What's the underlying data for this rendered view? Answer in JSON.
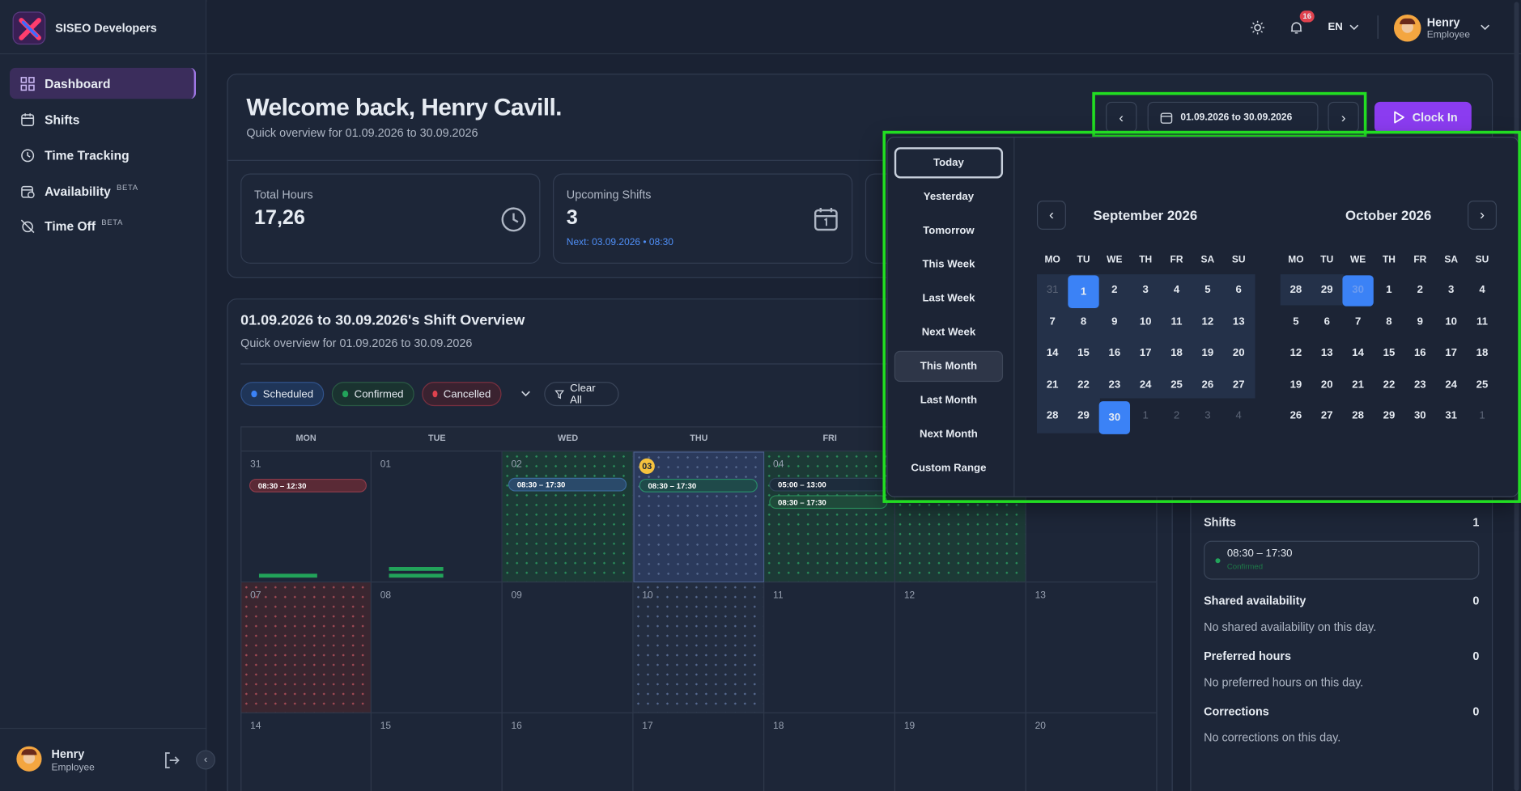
{
  "app": {
    "name": "SISEO Developers"
  },
  "nav": [
    {
      "label": "Dashboard",
      "badge": ""
    },
    {
      "label": "Shifts",
      "badge": ""
    },
    {
      "label": "Time Tracking",
      "badge": ""
    },
    {
      "label": "Availability",
      "badge": "BETA"
    },
    {
      "label": "Time Off",
      "badge": "BETA"
    }
  ],
  "user": {
    "name": "Henry",
    "role": "Employee",
    "notifications": "16",
    "language": "EN"
  },
  "header": {
    "title": "Welcome back, Henry Cavill.",
    "subtitle": "Quick overview for 01.09.2026 to 30.09.2026",
    "date_range": "01.09.2026 to 30.09.2026",
    "clock_in": "Clock In"
  },
  "stats": [
    {
      "label": "Total Hours",
      "value": "17,26",
      "sub": ""
    },
    {
      "label": "Upcoming Shifts",
      "value": "3",
      "sub": "Next: 03.09.2026 • 08:30"
    }
  ],
  "overview": {
    "title": "01.09.2026 to 30.09.2026's Shift Overview",
    "subtitle": "Quick overview for 01.09.2026 to 30.09.2026",
    "filters": [
      {
        "label": "Scheduled",
        "color": "#3b82f6"
      },
      {
        "label": "Confirmed",
        "color": "#22a35a"
      },
      {
        "label": "Cancelled",
        "color": "#e0424e"
      }
    ],
    "clear_all": "Clear All",
    "weekdays": [
      "MON",
      "TUE",
      "WED",
      "THU",
      "FRI"
    ],
    "week1": [
      "31",
      "01",
      "02",
      "03",
      "04"
    ],
    "week2": [
      "07",
      "08",
      "09",
      "10",
      "11",
      "12",
      "13"
    ],
    "week3": [
      "14",
      "15",
      "16",
      "17",
      "18",
      "19",
      "20"
    ],
    "shifts": {
      "d31": "08:30 – 12:30",
      "d02": "08:30 – 17:30",
      "d03": "08:30 – 17:30",
      "d04a": "05:00 – 13:00",
      "d04b": "08:30 – 17:30"
    }
  },
  "picker": {
    "presets": [
      "Today",
      "Yesterday",
      "Tomorrow",
      "This Week",
      "Last Week",
      "Next Week",
      "This Month",
      "Last Month",
      "Next Month",
      "Custom Range"
    ],
    "active_preset": "This Month",
    "weekday_heads": [
      "MO",
      "TU",
      "WE",
      "TH",
      "FR",
      "SA",
      "SU"
    ],
    "months": [
      {
        "title": "September 2026",
        "days": [
          "31",
          "1",
          "2",
          "3",
          "4",
          "5",
          "6",
          "7",
          "8",
          "9",
          "10",
          "11",
          "12",
          "13",
          "14",
          "15",
          "16",
          "17",
          "18",
          "19",
          "20",
          "21",
          "22",
          "23",
          "24",
          "25",
          "26",
          "27",
          "28",
          "29",
          "30",
          "1",
          "2",
          "3",
          "4"
        ]
      },
      {
        "title": "October 2026",
        "days": [
          "28",
          "29",
          "30",
          "1",
          "2",
          "3",
          "4",
          "5",
          "6",
          "7",
          "8",
          "9",
          "10",
          "11",
          "12",
          "13",
          "14",
          "15",
          "16",
          "17",
          "18",
          "19",
          "20",
          "21",
          "22",
          "23",
          "24",
          "25",
          "26",
          "27",
          "28",
          "29",
          "30",
          "31",
          "1"
        ]
      }
    ]
  },
  "day_panel": {
    "shifts_label": "Shifts",
    "shifts_count": "1",
    "shift_time": "08:30 – 17:30",
    "shift_status": "Confirmed",
    "shared_label": "Shared availability",
    "shared_count": "0",
    "shared_text": "No shared availability on this day.",
    "preferred_label": "Preferred hours",
    "preferred_count": "0",
    "preferred_text": "No preferred hours on this day.",
    "corrections_label": "Corrections",
    "corrections_count": "0",
    "corrections_text": "No corrections on this day."
  },
  "colors": {
    "accent": "#8b3cf0",
    "selected": "#3b82f6",
    "highlight": "#22dd22"
  }
}
